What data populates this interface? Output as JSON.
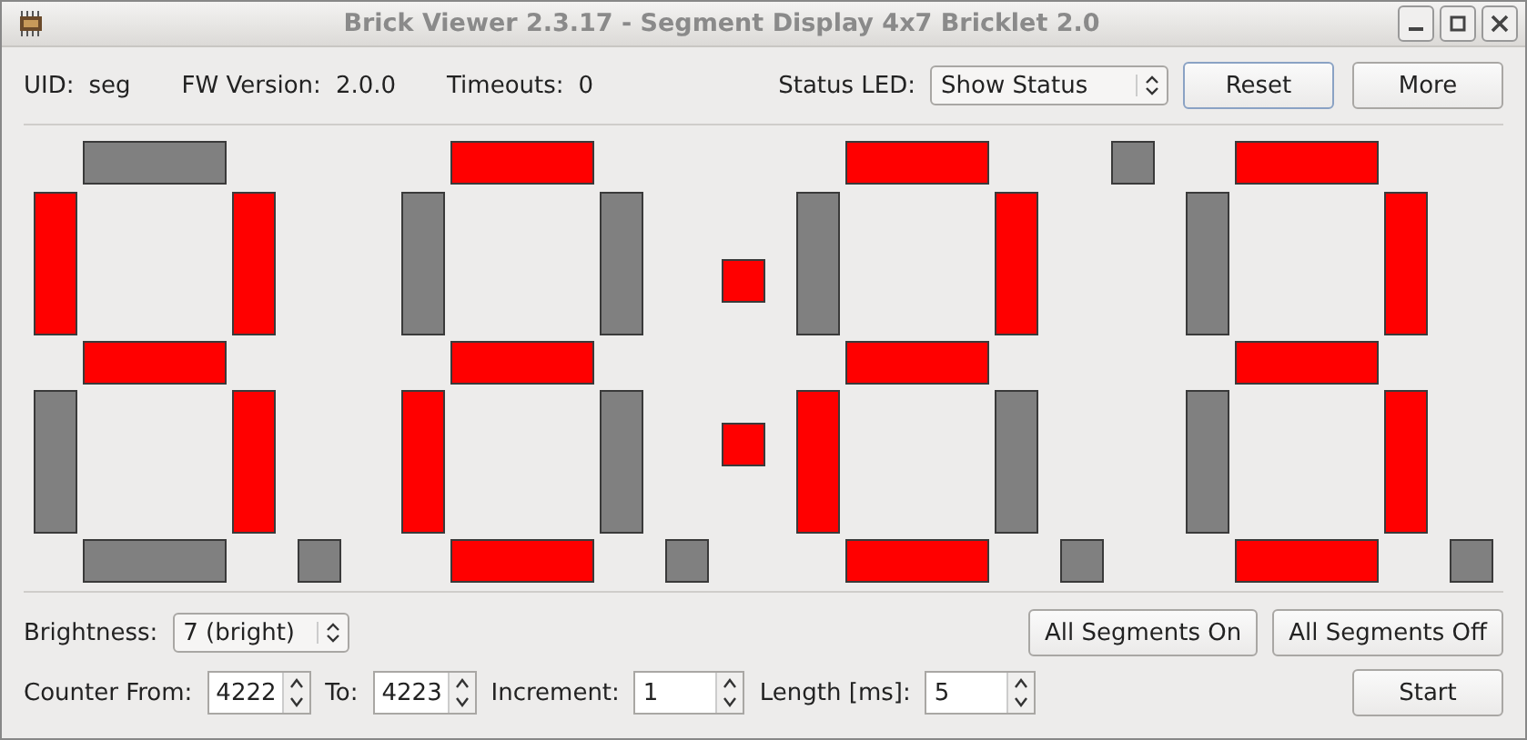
{
  "window": {
    "title": "Brick Viewer 2.3.17 - Segment Display 4x7 Bricklet 2.0"
  },
  "info": {
    "uid_label": "UID:",
    "uid": "seg",
    "fw_label": "FW Version:",
    "fw": "2.0.0",
    "timeouts_label": "Timeouts:",
    "timeouts": "0"
  },
  "status_led": {
    "label": "Status LED:",
    "value": "Show Status"
  },
  "buttons": {
    "reset": "Reset",
    "more": "More",
    "all_on": "All Segments On",
    "all_off": "All Segments Off",
    "start": "Start"
  },
  "display": {
    "digits": [
      {
        "top": false,
        "upper_left": true,
        "upper_right": true,
        "middle": true,
        "lower_left": false,
        "lower_right": true,
        "bottom": false,
        "dot": false
      },
      {
        "top": true,
        "upper_left": false,
        "upper_right": false,
        "middle": true,
        "lower_left": true,
        "lower_right": false,
        "bottom": true,
        "dot": false
      },
      {
        "top": true,
        "upper_left": false,
        "upper_right": true,
        "middle": true,
        "lower_left": true,
        "lower_right": false,
        "bottom": true,
        "dot": false
      },
      {
        "top": true,
        "upper_left": false,
        "upper_right": true,
        "middle": true,
        "lower_left": false,
        "lower_right": true,
        "bottom": true,
        "dot": false
      }
    ],
    "colon_upper": true,
    "colon_lower": true,
    "tick": false
  },
  "brightness": {
    "label": "Brightness:",
    "value": "7 (bright)"
  },
  "counter": {
    "from_label": "Counter From:",
    "from": "4222",
    "to_label": "To:",
    "to": "4223",
    "increment_label": "Increment:",
    "increment": "1",
    "length_label": "Length [ms]:",
    "length": "5"
  }
}
